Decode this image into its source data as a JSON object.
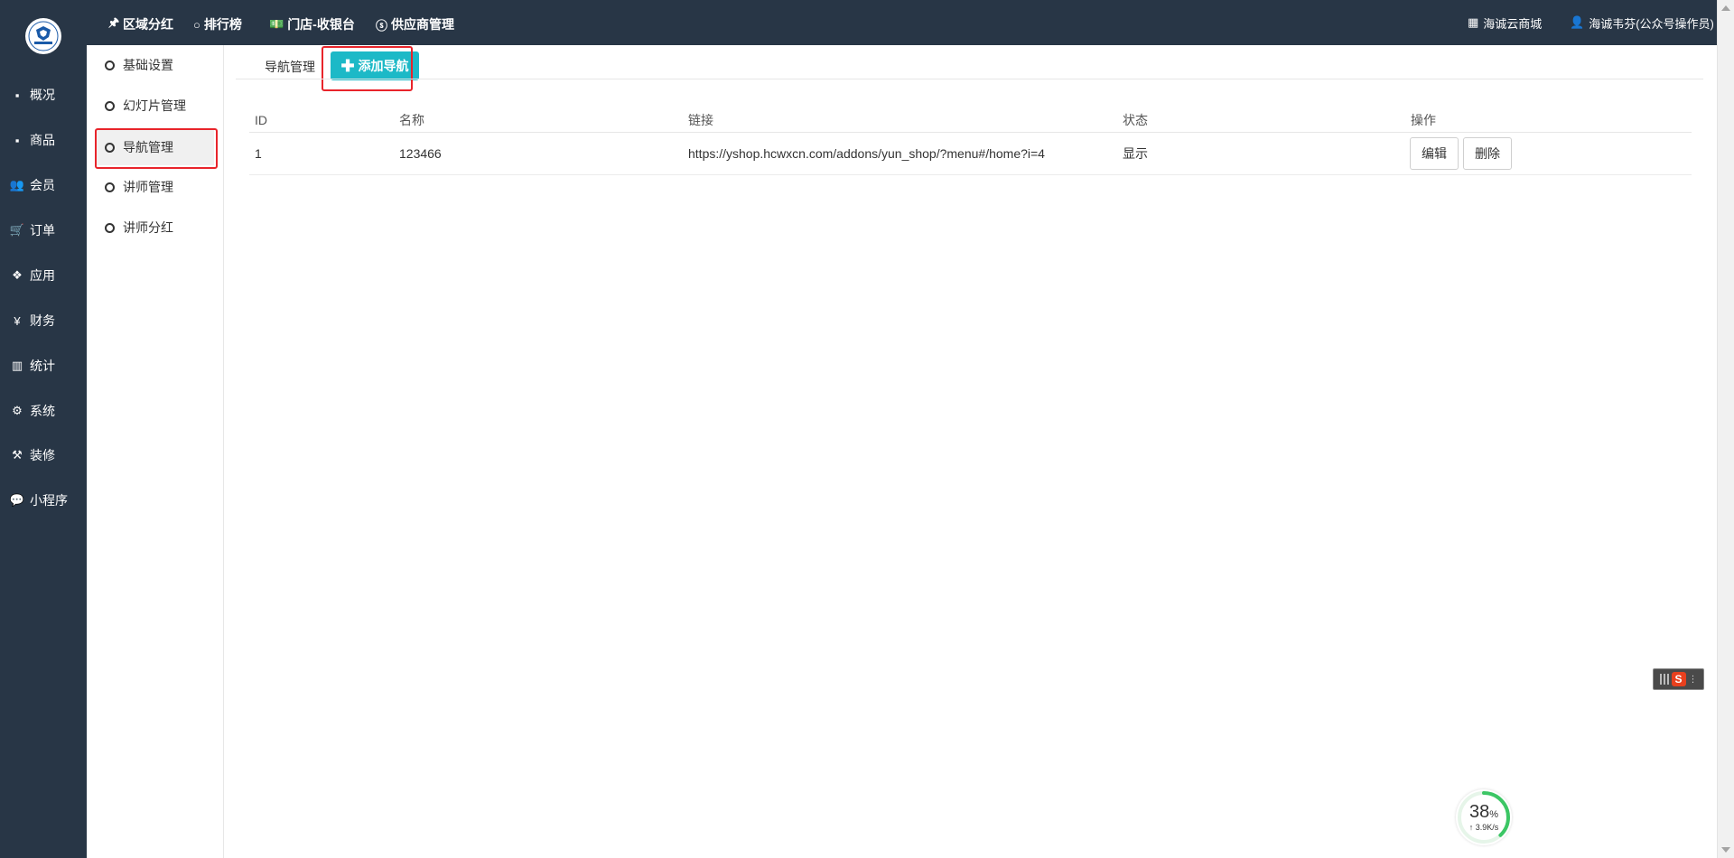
{
  "sidebar": {
    "items": [
      {
        "icon": "archive-icon",
        "glyph": "▪",
        "label": "概况"
      },
      {
        "icon": "archive-icon",
        "glyph": "▪",
        "label": "商品"
      },
      {
        "icon": "users-icon",
        "glyph": "👥",
        "label": "会员"
      },
      {
        "icon": "cart-icon",
        "glyph": "🛒",
        "label": "订单"
      },
      {
        "icon": "cubes-icon",
        "glyph": "❖",
        "label": "应用"
      },
      {
        "icon": "yen-icon",
        "glyph": "¥",
        "label": "财务"
      },
      {
        "icon": "bar-chart-icon",
        "glyph": "▥",
        "label": "统计"
      },
      {
        "icon": "cogs-icon",
        "glyph": "⚙",
        "label": "系统"
      },
      {
        "icon": "gavel-icon",
        "glyph": "⚒",
        "label": "装修"
      },
      {
        "icon": "wechat-icon",
        "glyph": "💬",
        "label": "小程序"
      }
    ]
  },
  "topbar": {
    "nav": [
      {
        "icon": "pin-icon",
        "glyph": "🖈",
        "label": "区域分红"
      },
      {
        "icon": "circle-icon",
        "glyph": "○",
        "label": "排行榜"
      },
      {
        "icon": "money-icon",
        "glyph": "💵",
        "label": "门店-收银台"
      },
      {
        "icon": "skype-icon",
        "glyph": "ⓢ",
        "label": "供应商管理"
      }
    ],
    "right": [
      {
        "icon": "grid-icon",
        "glyph": "▦",
        "label": "海诚云商城"
      },
      {
        "icon": "user-icon",
        "glyph": "👤",
        "label": "海诚韦芬(公众号操作员)"
      }
    ]
  },
  "submenu": {
    "items": [
      "基础设置",
      "幻灯片管理",
      "导航管理",
      "讲师管理",
      "讲师分红"
    ],
    "active_index": 2
  },
  "main": {
    "tab_label": "导航管理",
    "add_button": "添加导航",
    "table": {
      "headers": [
        "ID",
        "名称",
        "链接",
        "状态",
        "操作"
      ],
      "rows": [
        {
          "id": "1",
          "name": "123466",
          "link": "https://yshop.hcwxcn.com/addons/yun_shop/?menu#/home?i=4",
          "status": "显示"
        }
      ],
      "actions": [
        "编辑",
        "删除"
      ]
    }
  },
  "widgets": {
    "ime_letter": "S",
    "speed_percent": "38",
    "speed_percent_unit": "%",
    "speed_rate": "↑ 3.9K/s",
    "speed_fraction": 0.38
  },
  "colors": {
    "sidebar_bg": "#283646",
    "accent": "#1cb9c7",
    "highlight_box": "#e8242b"
  }
}
